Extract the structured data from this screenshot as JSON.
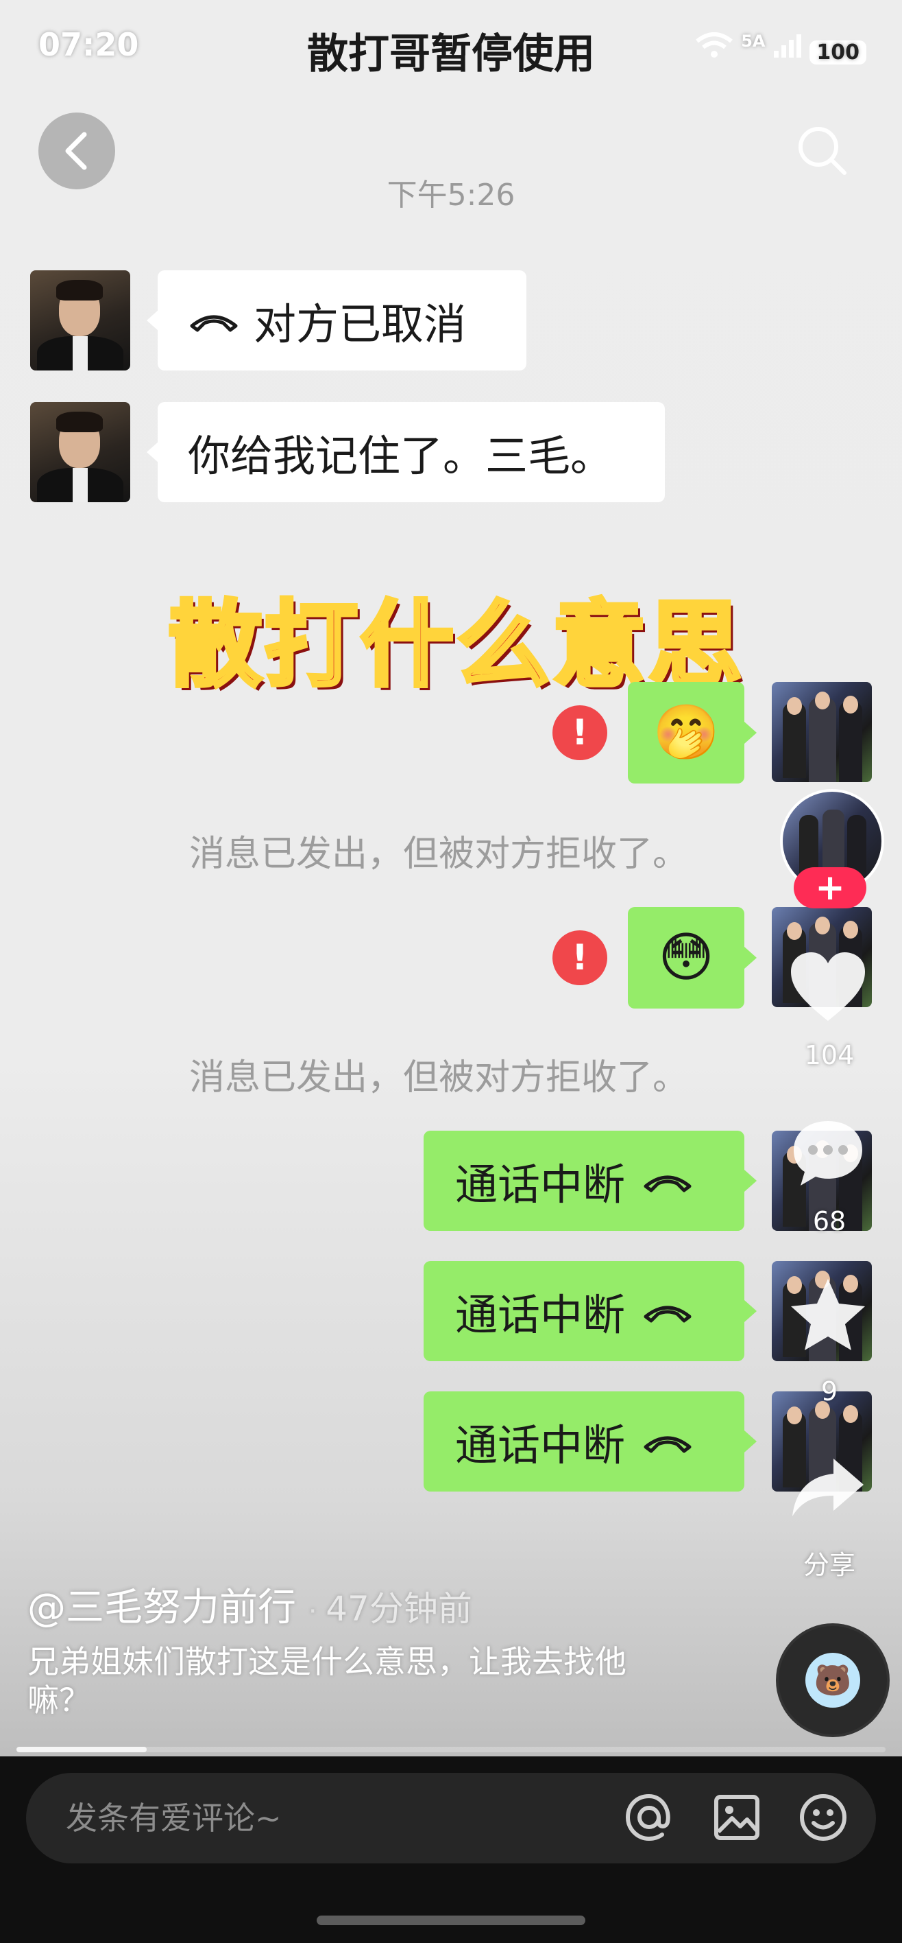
{
  "status_bar": {
    "time": "07:20",
    "network": "5A",
    "battery": "100"
  },
  "nav": {
    "title": "散打哥暂停使用"
  },
  "chat": {
    "timestamp": "下午5:26",
    "incoming": [
      {
        "text": "对方已取消",
        "icon": "phone-hangup-icon"
      },
      {
        "text": "你给我记住了。三毛。"
      }
    ],
    "overlay_title": "散打什么意思",
    "outgoing_failed": [
      {
        "emoji": "🤭",
        "notice": "消息已发出，但被对方拒收了。"
      },
      {
        "emoji": "😳",
        "notice": "消息已发出，但被对方拒收了。"
      }
    ],
    "calls": [
      {
        "text": "通话中断",
        "icon": "phone-hangup-icon"
      },
      {
        "text": "通话中断",
        "icon": "phone-hangup-icon"
      },
      {
        "text": "通话中断",
        "icon": "phone-hangup-icon"
      }
    ]
  },
  "video_actions": {
    "like_count": "104",
    "comment_count": "68",
    "favorite_count": "9",
    "share_label": "分享"
  },
  "post": {
    "author": "@三毛努力前行",
    "time_ago": "47分钟前",
    "caption": "兄弟姐妹们散打这是什么意思，让我去找他嘛？"
  },
  "playback": {
    "progress": 0.15
  },
  "comment_input": {
    "placeholder": "发条有爱评论~"
  },
  "colors": {
    "bubble_green": "#95ec69",
    "error_red": "#f0474b",
    "follow_pink": "#fe2c55"
  }
}
